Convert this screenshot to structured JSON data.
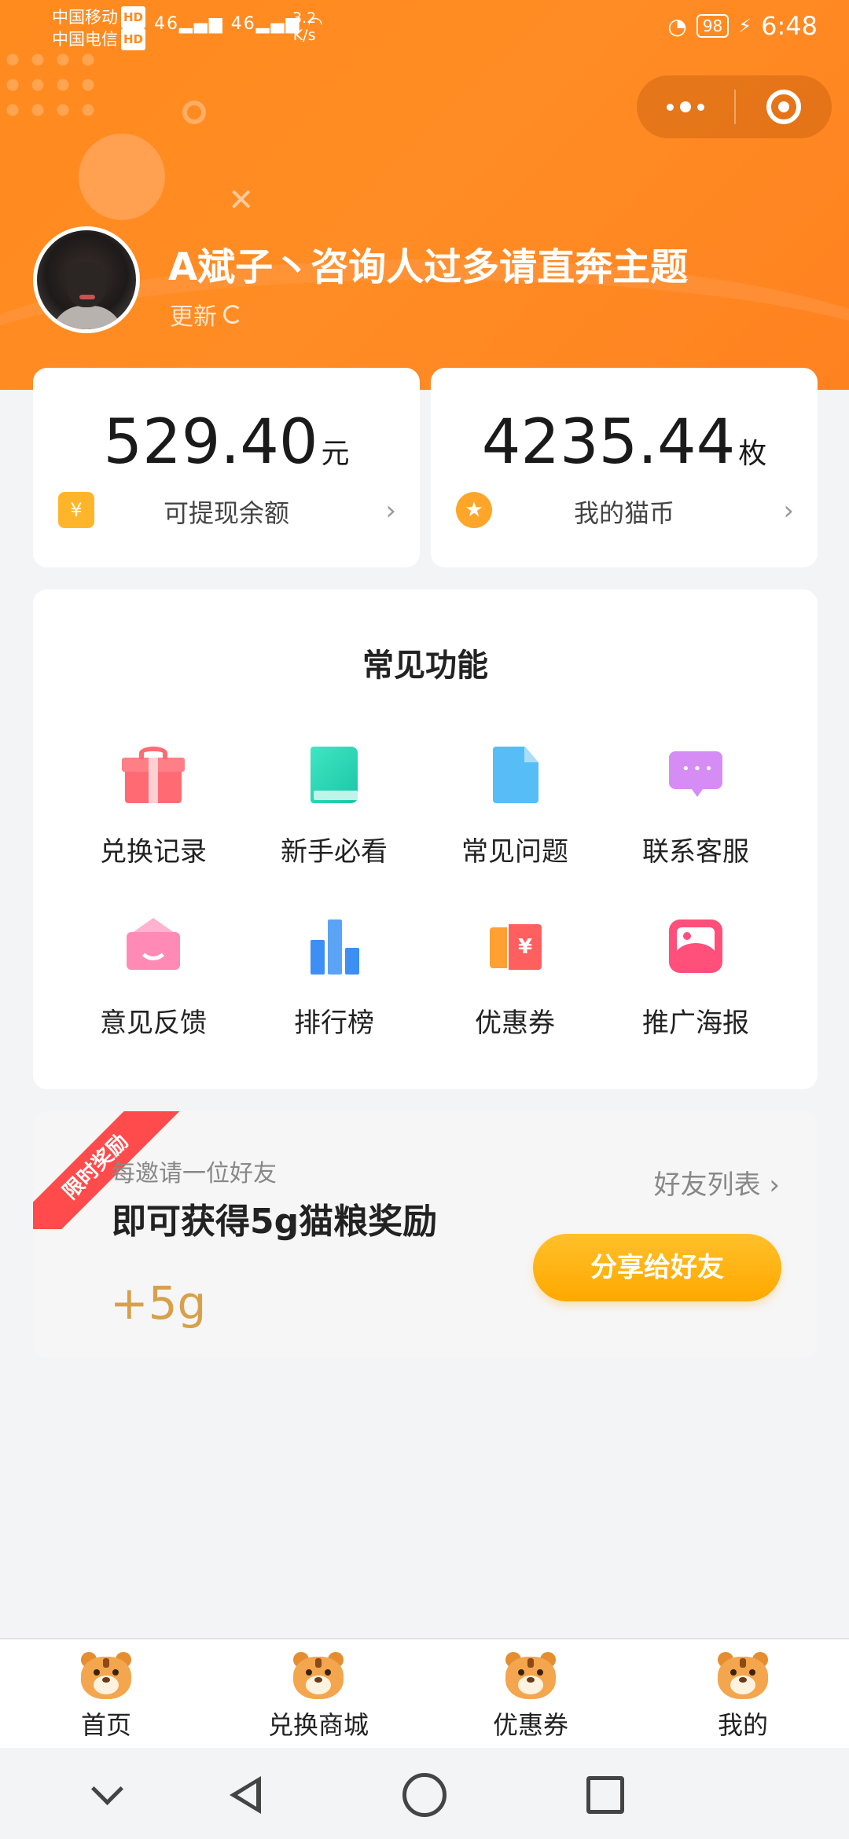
{
  "status_bar": {
    "carrier_1": "中国移动",
    "carrier_2": "中国电信",
    "hd": "HD",
    "signal_1": "46",
    "signal_2": "46",
    "net_speed": "3.2",
    "net_speed_unit": "K/s",
    "battery": "98",
    "time": "6:48"
  },
  "profile": {
    "nickname": "A斌子丶咨询人过多请直奔主题",
    "update_label": "更新"
  },
  "balance": {
    "cash_amount": "529.40",
    "cash_unit": "元",
    "cash_label": "可提现余额",
    "coin_amount": "4235.44",
    "coin_unit": "枚",
    "coin_label": "我的猫币",
    "wallet_glyph": "¥",
    "coin_glyph": "★",
    "arrow": "›"
  },
  "features": {
    "title": "常见功能",
    "items": [
      {
        "label": "兑换记录",
        "icon": "gift-icon"
      },
      {
        "label": "新手必看",
        "icon": "book-icon"
      },
      {
        "label": "常见问题",
        "icon": "document-icon"
      },
      {
        "label": "联系客服",
        "icon": "chat-icon"
      },
      {
        "label": "意见反馈",
        "icon": "envelope-icon"
      },
      {
        "label": "排行榜",
        "icon": "bar-chart-icon"
      },
      {
        "label": "优惠券",
        "icon": "coupon-icon"
      },
      {
        "label": "推广海报",
        "icon": "poster-icon"
      }
    ],
    "coupon_glyph": "¥"
  },
  "invite": {
    "ribbon": "限时奖励",
    "subtitle": "每邀请一位好友",
    "headline": "即可获得5g猫粮奖励",
    "reward": "+5g",
    "friends_link": "好友列表 ›",
    "share_button": "分享给好友"
  },
  "tabbar": {
    "tabs": [
      "首页",
      "兑换商城",
      "优惠券",
      "我的"
    ]
  },
  "colors": {
    "brand_orange": "#ff8a1e",
    "share_button": "#ffb000",
    "ribbon_red": "#ff4b4b",
    "reward_gold": "#d6a14a"
  }
}
